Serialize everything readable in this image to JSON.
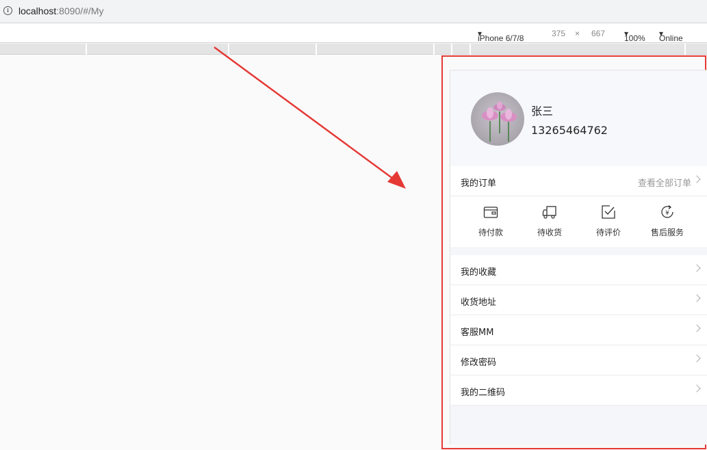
{
  "browser": {
    "url_host": "localhost",
    "url_rest": ":8090/#/My"
  },
  "devtools": {
    "device": "iPhone 6/7/8",
    "width": "375",
    "times": "×",
    "height": "667",
    "zoom": "100%",
    "network": "Online"
  },
  "profile": {
    "name": "张三",
    "phone": "13265464762"
  },
  "orders": {
    "title": "我的订单",
    "view_all": "查看全部订单",
    "items": [
      {
        "label": "待付款",
        "icon": "wallet-icon"
      },
      {
        "label": "待收货",
        "icon": "truck-icon"
      },
      {
        "label": "待评价",
        "icon": "review-icon"
      },
      {
        "label": "售后服务",
        "icon": "refund-icon"
      }
    ]
  },
  "menu": [
    {
      "label": "我的收藏"
    },
    {
      "label": "收货地址"
    },
    {
      "label": "客服MM"
    },
    {
      "label": "修改密码"
    },
    {
      "label": "我的二维码"
    }
  ],
  "colors": {
    "annotation_red": "#e53935"
  }
}
